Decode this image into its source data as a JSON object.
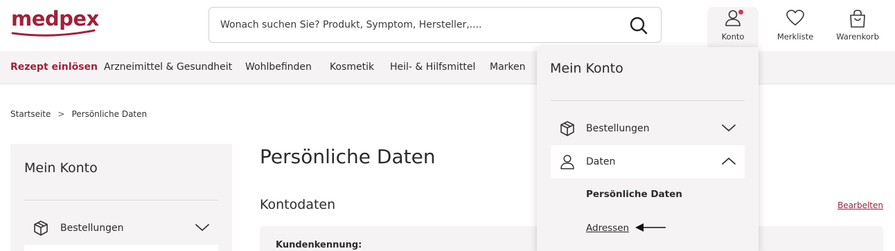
{
  "brand": {
    "name": "medpex",
    "color": "#a0213a"
  },
  "search": {
    "placeholder": "Wonach suchen Sie? Produkt, Symptom, Hersteller,...."
  },
  "header_actions": [
    {
      "label": "Konto",
      "icon": "user-icon",
      "has_notification": true
    },
    {
      "label": "Merkliste",
      "icon": "heart-icon"
    },
    {
      "label": "Warenkorb",
      "icon": "shopping-bag-icon"
    }
  ],
  "nav": {
    "items": [
      "Rezept einlösen",
      "Arzneimittel & Gesundheit",
      "Wohlbefinden",
      "Kosmetik",
      "Heil- & Hilfsmittel",
      "Marken"
    ]
  },
  "breadcrumb": {
    "items": [
      "Startseite",
      "Persönliche Daten"
    ],
    "separator": ">"
  },
  "sidebar": {
    "title": "Mein Konto",
    "items": [
      {
        "label": "Bestellungen",
        "icon": "package-icon",
        "expanded": false
      }
    ]
  },
  "main": {
    "page_title": "Persönliche Daten",
    "section_title": "Kontodaten",
    "edit_label": "Bearbelten",
    "field_label": "Kundenkennung:"
  },
  "dropdown": {
    "title": "Mein Konto",
    "items": [
      {
        "label": "Bestellungen",
        "icon": "package-icon",
        "expanded": false
      },
      {
        "label": "Daten",
        "icon": "user-icon",
        "expanded": true
      }
    ],
    "sub_items": [
      "Persönliche Daten",
      "Adressen"
    ]
  }
}
